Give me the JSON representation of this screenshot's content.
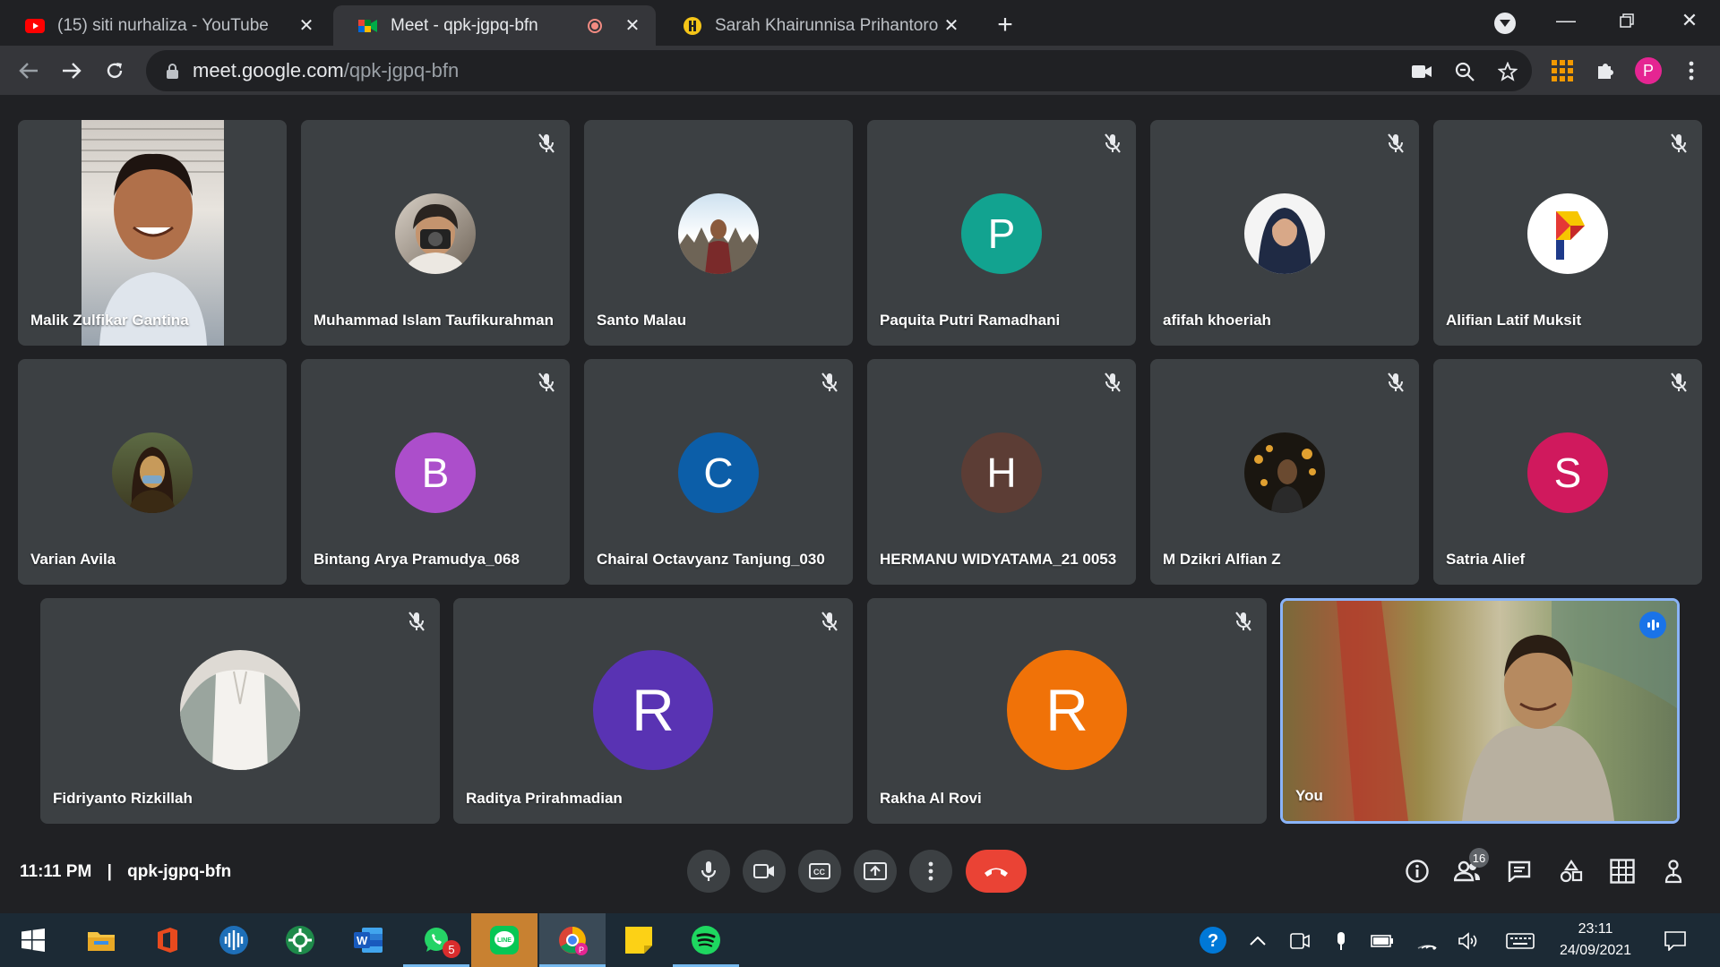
{
  "browser": {
    "tabs": [
      {
        "title": "(15) siti nurhaliza - YouTube",
        "favicon": "youtube-icon"
      },
      {
        "title": "Meet - qpk-jgpq-bfn",
        "favicon": "google-meet-icon",
        "recording": true
      },
      {
        "title": "Sarah Khairunnisa Prihantoro - Pr",
        "favicon": "site-icon"
      }
    ],
    "url_host": "meet.google.com",
    "url_path": "/qpk-jgpq-bfn",
    "profile_initial": "P"
  },
  "meet": {
    "tiles_row1": [
      {
        "name": "Malik Zulfikar Gantina",
        "type": "video"
      },
      {
        "name": "Muhammad Islam Taufikurahman",
        "type": "photo"
      },
      {
        "name": "Santo Malau",
        "type": "photo"
      },
      {
        "name": "Paquita Putri Ramadhani",
        "initial": "P",
        "color": "#12a390"
      },
      {
        "name": "afifah khoeriah",
        "type": "photo"
      },
      {
        "name": "Alifian Latif Muksit",
        "type": "logo"
      }
    ],
    "tiles_row2": [
      {
        "name": "Varian Avila",
        "type": "photo"
      },
      {
        "name": "Bintang Arya Pramudya_068",
        "initial": "B",
        "color": "#ac4ecb"
      },
      {
        "name": "Chairal Octavyanz Tanjung_030",
        "initial": "C",
        "color": "#0c5ea8"
      },
      {
        "name": "HERMANU WIDYATAMA_21 0053",
        "initial": "H",
        "color": "#5c3d35"
      },
      {
        "name": "M Dzikri Alfian Z",
        "type": "photo"
      },
      {
        "name": "Satria Alief",
        "initial": "S",
        "color": "#d0195d"
      }
    ],
    "tiles_row3": [
      {
        "name": "Fidriyanto Rizkillah",
        "type": "photo"
      },
      {
        "name": "Raditya Prirahmadian",
        "initial": "R",
        "color": "#5933b3"
      },
      {
        "name": "Rakha Al Rovi",
        "initial": "R",
        "color": "#f07208"
      },
      {
        "name": "You",
        "type": "video",
        "speaking": true
      }
    ],
    "time": "11:11 PM",
    "meeting_code": "qpk-jgpq-bfn",
    "participant_count": "16",
    "end_color": "#ea4335"
  },
  "taskbar": {
    "apps": [
      "start",
      "file-explorer",
      "office",
      "audio-app",
      "mobile-app",
      "word",
      "whatsapp",
      "line",
      "chrome",
      "sticky-notes",
      "spotify"
    ],
    "whatsapp_badge": "5",
    "time": "23:11",
    "date": "24/09/2021"
  }
}
